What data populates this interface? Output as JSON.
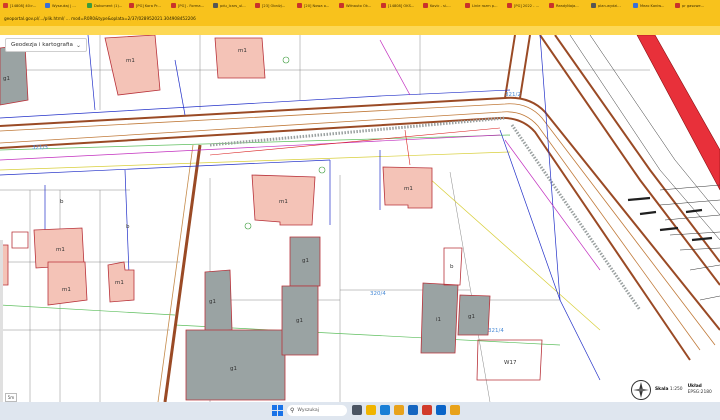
{
  "browser": {
    "tabs": [
      {
        "label": "[14808] 40>...",
        "color": "#d13b2b"
      },
      {
        "label": "Wyszukaj | ...",
        "color": "#3b6fd6"
      },
      {
        "label": "Dokument (1)...",
        "color": "#3c9b3c"
      },
      {
        "label": "[PG] Kora Pr...",
        "color": "#c9322b"
      },
      {
        "label": "[PG] - Forma...",
        "color": "#c9322b"
      },
      {
        "label": "pdu_lcars_ul...",
        "color": "#555555"
      },
      {
        "label": "[23] Obniżj...",
        "color": "#c9322b"
      },
      {
        "label": "[20] Nowa o...",
        "color": "#c9322b"
      },
      {
        "label": "Wiłnauto Ok...",
        "color": "#c9322b"
      },
      {
        "label": "[14808] OKS...",
        "color": "#c9322b"
      },
      {
        "label": "Kovic - si-...",
        "color": "#c9322b"
      },
      {
        "label": "Linie rozm p...",
        "color": "#c9322b"
      },
      {
        "label": "[PG] 2022 - ...",
        "color": "#c9322b"
      },
      {
        "label": "ReadyNaja...",
        "color": "#c9322b"
      },
      {
        "label": "plan-wydzi...",
        "color": "#555555"
      },
      {
        "label": "Mezo Kaniw...",
        "color": "#3b6fd6"
      },
      {
        "label": "pr gasowe...",
        "color": "#c9322b"
      }
    ],
    "url": "geoportal.gov.pl/.../plik.html/ ... mod=R0R0&type&oplata=2/37/028952021.304908452206"
  },
  "map": {
    "layer_selector": "Geodezja i kartografia",
    "labels": {
      "m1": "m1",
      "g1": "g1",
      "i1": "i1",
      "b": "b",
      "p1": "321/4",
      "p2": "320/4",
      "p3": "321/2",
      "p4": "321/3",
      "w": "W17"
    },
    "zoom": "5m"
  },
  "scale_info": {
    "scale_label": "Skala",
    "scale_value": "1:250",
    "system_label": "Układ",
    "system_value": "EPSG:2180"
  },
  "taskbar": {
    "search_placeholder": "Wyszukaj",
    "apps": [
      {
        "name": "task-view",
        "color": "#4b5563"
      },
      {
        "name": "explorer",
        "color": "#f0b400"
      },
      {
        "name": "edge",
        "color": "#1a7fd6"
      },
      {
        "name": "files",
        "color": "#e8a21b"
      },
      {
        "name": "store",
        "color": "#1565c0"
      },
      {
        "name": "office",
        "color": "#d13b2b"
      },
      {
        "name": "outlook",
        "color": "#0a64c8"
      },
      {
        "name": "chrome",
        "color": "#e8a21b"
      }
    ]
  }
}
